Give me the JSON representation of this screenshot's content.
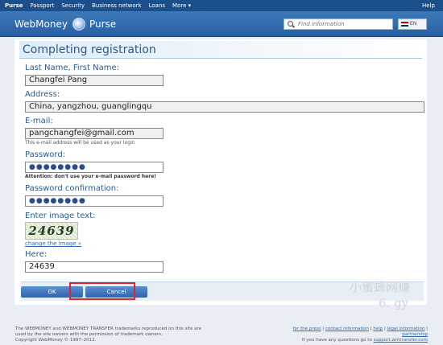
{
  "topnav": {
    "items": [
      "Purse",
      "Passport",
      "Security",
      "Business network",
      "Loans",
      "More ▾"
    ],
    "help": "Help"
  },
  "header": {
    "brand": "WebMoney",
    "product": "Purse",
    "search_placeholder": "Find information",
    "lang": "EN"
  },
  "form": {
    "title": "Completing registration",
    "name_label": "Last Name, First Name:",
    "name_value": "Changfei Pang",
    "address_label": "Address:",
    "address_value": "China, yangzhou, guanglingqu",
    "email_label": "E-mail:",
    "email_value": "pangchangfei@gmail.com",
    "email_note": "This e-mail address will be used as your login",
    "password_label": "Password:",
    "password_value": "●●●●●●●●",
    "password_note": "Attention: don't use your e-mail password here!",
    "confirm_label": "Password confirmation:",
    "confirm_value": "●●●●●●●●",
    "captcha_label": "Enter image text:",
    "captcha_text": "24639",
    "change_image": "change the image »",
    "here_label": "Here:",
    "here_value": "24639",
    "ok_label": "OK",
    "cancel_label": "Cancel"
  },
  "watermark": {
    "line1": "小蜜蜂网赚",
    "line2": "6. gy"
  },
  "footer": {
    "left_line1": "The WEBMONEY and WEBMONEY TRANSFER trademarks reproduced on this site are",
    "left_line2": "used by the site owners with the permission of trademark owners.",
    "left_line3": "Copyright WebMoney © 1997–2012.",
    "links": [
      "for the press",
      "contact information",
      "help",
      "legal information",
      "partnership"
    ],
    "support_text": "If you have any questions go to",
    "support_link": "support.wmtransfer.com"
  }
}
